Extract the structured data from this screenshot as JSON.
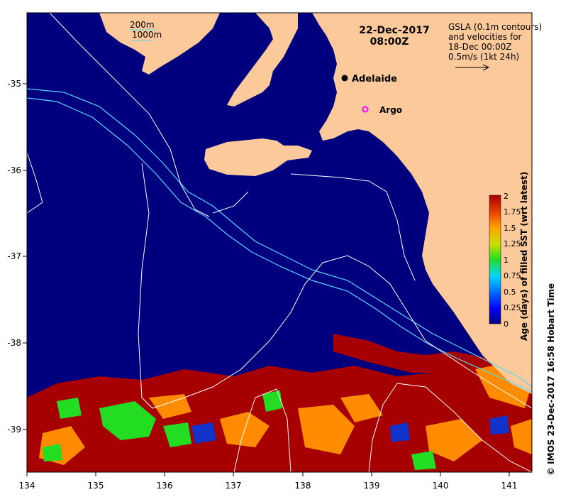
{
  "title": {
    "date": "22-Dec-2017",
    "time": "08:00Z"
  },
  "legend_depth": {
    "line1": "200m",
    "line2": "1000m"
  },
  "legend_gsla": {
    "line1": "GSLA (0.1m contours)",
    "line2": "and velocities for",
    "line3": "18-Dec 00:00Z",
    "line4": "0.5m/s (1kt 24h)"
  },
  "places": {
    "adelaide": "Adelaide",
    "argo": "Argo"
  },
  "colorbar": {
    "title": "Age (days) of filled SST (wrt latest)",
    "ticks": [
      "2",
      "1.75",
      "1.5",
      "1.25",
      "1",
      "0.75",
      "0.5",
      "0.25",
      "0"
    ]
  },
  "credit": "© IMOS 23-Dec-2017 16:58 Hobart Time",
  "axes": {
    "x_ticks": [
      "134",
      "135",
      "136",
      "137",
      "138",
      "139",
      "140",
      "141"
    ],
    "y_ticks": [
      "-35",
      "-36",
      "-37",
      "-38",
      "-39"
    ]
  },
  "colors": {
    "ocean": "#00007f",
    "land": "#fbc99a",
    "old_data": "#a60000",
    "contour": "#ffffff",
    "isobath": "#55d8ff",
    "argo_marker": "#ff00ff"
  }
}
